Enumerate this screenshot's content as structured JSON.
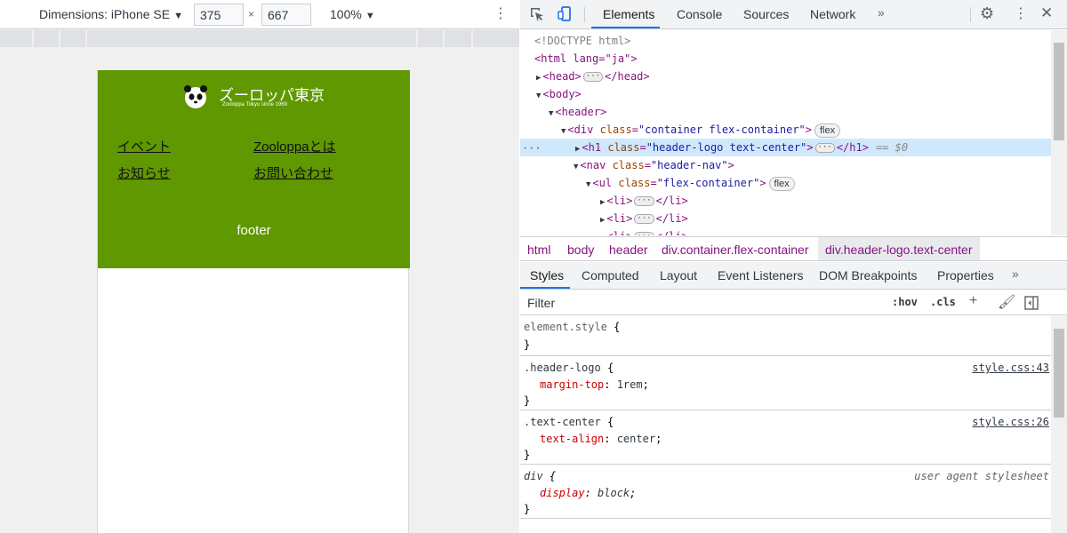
{
  "device_toolbar": {
    "dimensions_label": "Dimensions: iPhone SE",
    "width": "375",
    "height": "667",
    "zoom": "100%"
  },
  "site": {
    "title": "ズーロッパ東京",
    "subtitle": "Zooloppa Tokyo since 1969",
    "nav": [
      "イベント",
      "Zooloppaとは",
      "お知らせ",
      "お問い合わせ"
    ],
    "footer": "footer",
    "header_color": "#5f9800"
  },
  "devtools": {
    "tabs": [
      "Elements",
      "Console",
      "Sources",
      "Network"
    ],
    "active_tab": "Elements",
    "more": "»",
    "dom": {
      "doctype": "<!DOCTYPE html>",
      "html_open": "<html lang=\"ja\">",
      "head": "<head>",
      "head_close": "</head>",
      "body": "<body>",
      "header": "<header>",
      "div_tag": "<div",
      "div_attr": "class",
      "div_val": "\"container flex-container\"",
      "flex_pill": "flex",
      "h1_tag": "<h1",
      "h1_attr": "class",
      "h1_val": "\"header-logo text-center\"",
      "h1_close": "</h1>",
      "eq0": "== $0",
      "nav_tag": "<nav",
      "nav_attr": "class",
      "nav_val": "\"header-nav\"",
      "ul_tag": "<ul",
      "ul_attr": "class",
      "ul_val": "\"flex-container\"",
      "li_open": "<li>",
      "li_close": "</li>"
    },
    "breadcrumbs": [
      "html",
      "body",
      "header",
      "div.container.flex-container",
      "div.header-logo.text-center"
    ],
    "sub_tabs": [
      "Styles",
      "Computed",
      "Layout",
      "Event Listeners",
      "DOM Breakpoints",
      "Properties"
    ],
    "filter_placeholder": "Filter",
    "hov": ":hov",
    "cls": ".cls",
    "rules": [
      {
        "selector": "element.style",
        "props": [],
        "source": ""
      },
      {
        "selector": ".header-logo",
        "props": [
          {
            "name": "margin-top",
            "value": "1rem"
          }
        ],
        "source": "style.css:43"
      },
      {
        "selector": ".text-center",
        "props": [
          {
            "name": "text-align",
            "value": "center"
          }
        ],
        "source": "style.css:26"
      },
      {
        "selector": "div",
        "props": [
          {
            "name": "display",
            "value": "block"
          }
        ],
        "source": "user agent stylesheet"
      }
    ]
  }
}
